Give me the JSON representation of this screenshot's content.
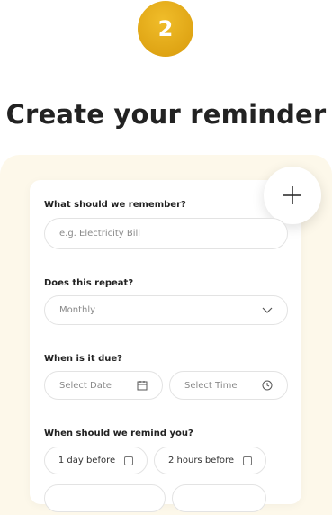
{
  "step": {
    "number": "2"
  },
  "title": "Create your reminder",
  "form": {
    "remember": {
      "label": "What should we remember?",
      "placeholder": "e.g. Electricity Bill"
    },
    "repeat": {
      "label": "Does this repeat?",
      "value": "Monthly"
    },
    "due": {
      "label": "When is it due?",
      "date_placeholder": "Select Date",
      "time_placeholder": "Select Time"
    },
    "remind": {
      "label": "When should we remind you?",
      "options": [
        {
          "label": "1 day before",
          "checked": false
        },
        {
          "label": "2 hours before",
          "checked": false
        }
      ]
    }
  },
  "icons": {
    "add": "plus-icon",
    "dropdown": "chevron-down-icon",
    "date": "calendar-icon",
    "time": "clock-icon"
  },
  "colors": {
    "accent": "#e0a615",
    "panel": "#fdf8ea",
    "border": "#e3e3e3"
  }
}
